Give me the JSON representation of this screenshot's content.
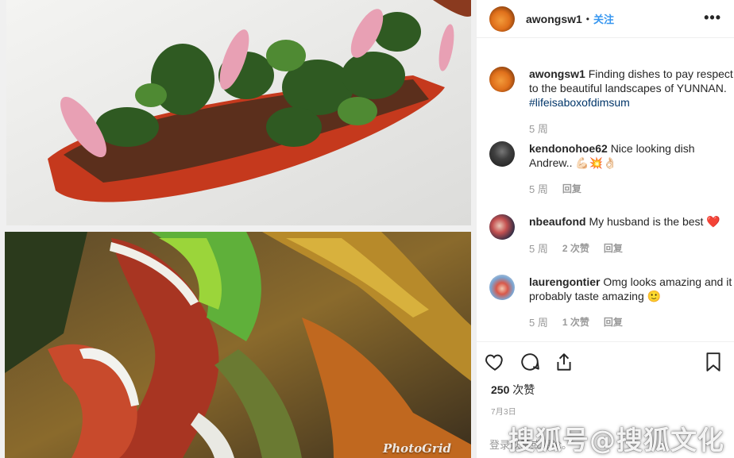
{
  "post": {
    "username": "awongsw1",
    "follow_label": "关注",
    "more_label": "•••",
    "watermark": "PhotoGrid"
  },
  "comments": [
    {
      "username": "awongsw1",
      "text": "Finding dishes to pay respect to the beautiful landscapes of YUNNAN.",
      "hashtag": "#lifeisaboxofdimsum",
      "time": "5 周"
    },
    {
      "username": "kendonohoe62",
      "text": "Nice looking dish Andrew.. 💪🏻💥👌🏻",
      "time": "5 周",
      "reply": "回复"
    },
    {
      "username": "nbeaufond",
      "text": "My husband is the best ❤️",
      "time": "5 周",
      "likes": "2 次赞",
      "reply": "回复"
    },
    {
      "username": "laurengontier",
      "text": "Omg looks amazing and it probably taste amazing 🙂",
      "time": "5 周",
      "likes": "1 次赞",
      "reply": "回复"
    }
  ],
  "likes": {
    "count": "250",
    "label": "次赞"
  },
  "date": "7月3日",
  "login_prompt": "登录以赞或评论。",
  "overlay_watermark": "搜狐号@搜狐文化",
  "colors": {
    "accent": "#3897f0",
    "hashtag": "#003569",
    "muted": "#999999",
    "text": "#262626"
  },
  "icons": [
    "heart-icon",
    "comment-icon",
    "share-icon",
    "bookmark-icon",
    "more-icon"
  ]
}
